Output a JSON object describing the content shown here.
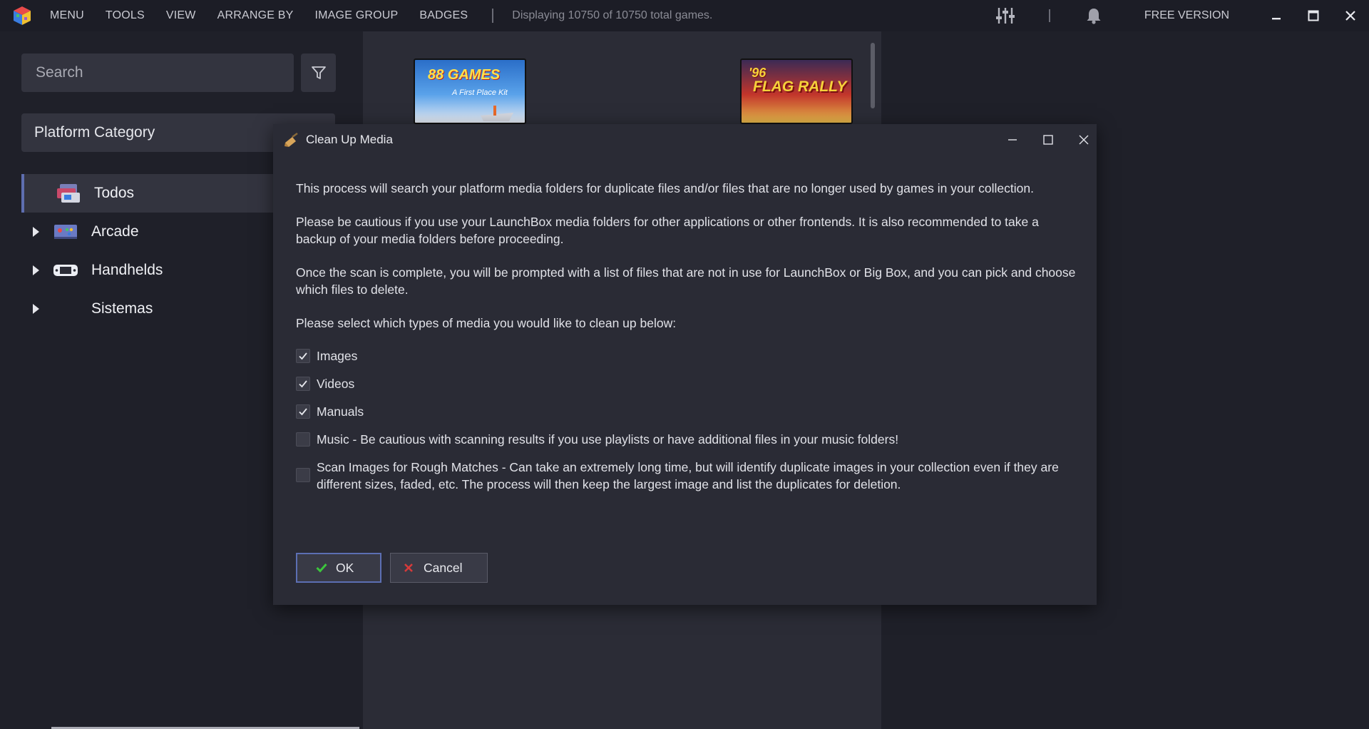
{
  "app": {
    "menu": [
      "MENU",
      "TOOLS",
      "VIEW",
      "ARRANGE BY",
      "IMAGE GROUP",
      "BADGES"
    ],
    "status_text": "Displaying 10750 of 10750 total games.",
    "free_version": "FREE VERSION"
  },
  "sidebar": {
    "search_placeholder": "Search",
    "platform_dropdown": "Platform Category",
    "tree": [
      {
        "label": "Todos",
        "selected": true
      },
      {
        "label": "Arcade"
      },
      {
        "label": "Handhelds"
      },
      {
        "label": "Sistemas"
      }
    ]
  },
  "games": {
    "box_a_text": "88 GAMES",
    "box_a_sub": "A First Place Kit",
    "box_b_text": "FLAG RALLY",
    "box_b_prefix": "'96"
  },
  "dialog": {
    "title": "Clean Up Media",
    "para1": "This process will search your platform media folders for duplicate files and/or files that are no longer used by games in your collection.",
    "para2": "Please be cautious if you use your LaunchBox media folders for other applications or other frontends. It is also recommended to take a backup of your media folders before proceeding.",
    "para3": "Once the scan is complete, you will be prompted with a list of files that are not in use for LaunchBox or Big Box, and you can pick and choose which files to delete.",
    "para4": "Please select which types of media you would like to clean up below:",
    "options": [
      {
        "label": "Images",
        "checked": true
      },
      {
        "label": "Videos",
        "checked": true
      },
      {
        "label": "Manuals",
        "checked": true
      },
      {
        "label": "Music - Be cautious with scanning results if you use playlists or have additional files in your music folders!",
        "checked": false
      },
      {
        "label": "Scan Images for Rough Matches - Can take an extremely long time, but will identify duplicate images in your collection even if they are different sizes, faded, etc. The process will then keep the largest image and list the duplicates for deletion.",
        "checked": false
      }
    ],
    "ok_label": "OK",
    "cancel_label": "Cancel"
  },
  "colors": {
    "accent": "#5c6fb3",
    "background": "#1f2029",
    "panel": "#2b2c36",
    "dialog": "#2a2b35",
    "ok_check": "#3cc63c",
    "cancel_x": "#d63a3a"
  }
}
